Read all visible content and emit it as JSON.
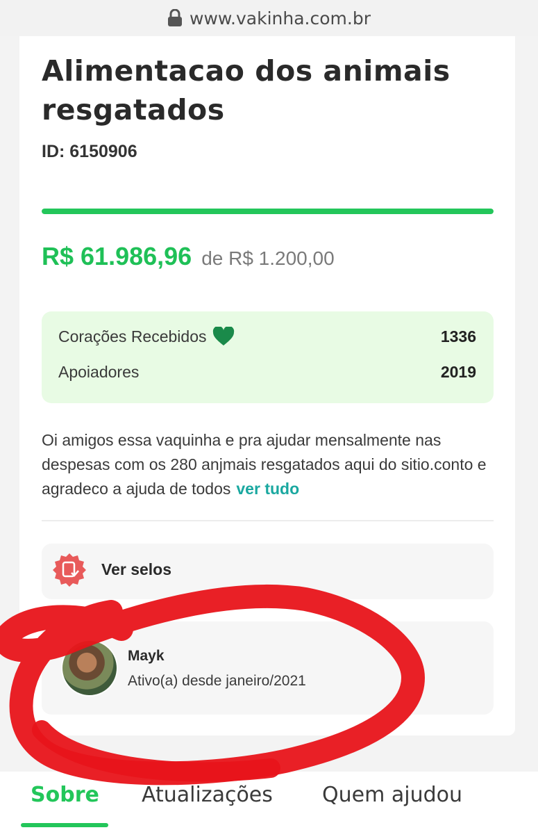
{
  "browser": {
    "url": "www.vakinha.com.br",
    "lock_icon": "lock-icon"
  },
  "campaign": {
    "title": "Alimentacao dos animais resgatados",
    "id_text": "ID: 6150906",
    "progress_fraction": 1.0,
    "raised": "R$ 61.986,96",
    "goal": "de R$ 1.200,00",
    "description": "Oi amigos essa vaquinha e pra ajudar mensalmente nas despesas com os 280 anjmais resgatados aqui do sitio.conto e agradeco a ajuda de todos",
    "see_all": "ver tudo"
  },
  "stats": {
    "hearts_label": "Corações Recebidos",
    "hearts_value": "1336",
    "supporters_label": "Apoiadores",
    "supporters_value": "2019"
  },
  "seals": {
    "label": "Ver selos"
  },
  "creator": {
    "name": "Mayk",
    "since": "Ativo(a) desde janeiro/2021"
  },
  "tabs": [
    {
      "label": "Sobre",
      "active": true
    },
    {
      "label": "Atualizações",
      "active": false
    },
    {
      "label": "Quem ajudou",
      "active": false
    }
  ],
  "colors": {
    "accent_green": "#23c65a",
    "link_teal": "#1aa8a0",
    "stats_bg": "#e8fbe4",
    "heart": "#1a8a4a",
    "annotation_red": "#e8141a"
  }
}
